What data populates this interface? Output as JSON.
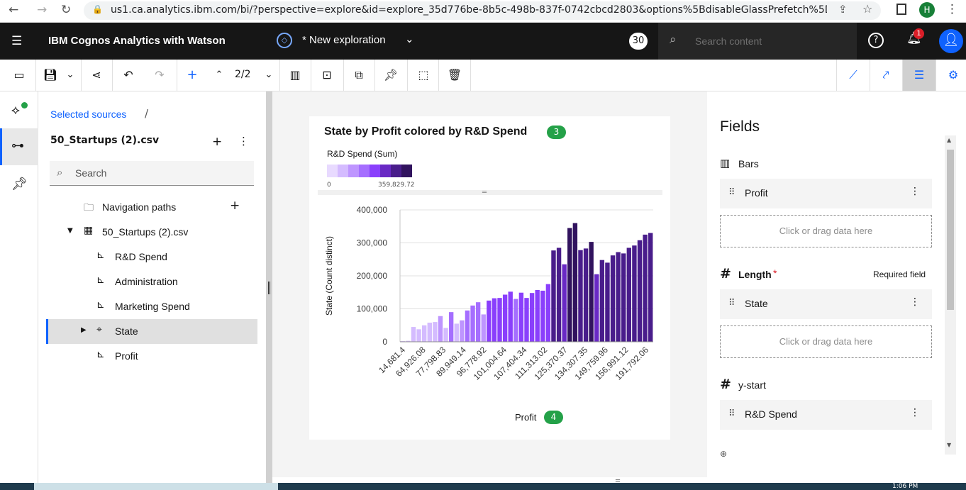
{
  "browser": {
    "url": "us1.ca.analytics.ibm.com/bi/?perspective=explore&id=explore_35d776be-8b5c-498b-837f-0742cbcd2803&options%5BdisableGlassPrefetch%5D=tr...",
    "profile_initial": "H"
  },
  "header": {
    "app_name": "IBM Cognos Analytics with Watson",
    "exploration_title": "* New exploration",
    "count": "30",
    "search_placeholder": "Search content",
    "notification_count": "1"
  },
  "toolbar": {
    "page_indicator": "2/2"
  },
  "sources": {
    "breadcrumb": "Selected sources",
    "breadcrumb_sep": "/",
    "file_name": "50_Startups (2).csv",
    "search_placeholder": "Search",
    "tree": [
      {
        "label": "Navigation paths",
        "icon": "folder-icon"
      },
      {
        "label": "50_Startups (2).csv",
        "icon": "table-icon"
      },
      {
        "label": "R&D Spend",
        "icon": "measure-icon"
      },
      {
        "label": "Administration",
        "icon": "measure-icon"
      },
      {
        "label": "Marketing Spend",
        "icon": "measure-icon"
      },
      {
        "label": "State",
        "icon": "location-icon"
      },
      {
        "label": "Profit",
        "icon": "measure-icon"
      }
    ]
  },
  "card": {
    "title": "State by Profit colored by R&D Spend",
    "title_badge": "3",
    "legend_title": "R&D Spend (Sum)",
    "legend_min": "0",
    "legend_max": "359,829.72",
    "x_badge": "4",
    "colors": [
      "#e8daff",
      "#d4bbff",
      "#be95ff",
      "#a56eff",
      "#8a3ffc",
      "#6929c4",
      "#491d8b",
      "#31135e"
    ]
  },
  "chart_data": {
    "type": "bar",
    "title": "State by Profit colored by R&D Spend",
    "xlabel": "Profit",
    "ylabel": "State (Count distinct)",
    "ylim": [
      0,
      400000
    ],
    "y_ticks": [
      "0",
      "100,000",
      "200,000",
      "300,000",
      "400,000"
    ],
    "x_tick_labels": [
      "14,681.4",
      "64,926.08",
      "77,798.83",
      "89,949.14",
      "96,778.92",
      "101,004.64",
      "107,404.34",
      "111,313.02",
      "125,370.37",
      "134,307.35",
      "149,759.96",
      "156,991.12",
      "191,792.06"
    ],
    "values": [
      2000,
      3000,
      45000,
      38000,
      50000,
      58000,
      60000,
      78000,
      42000,
      90000,
      55000,
      65000,
      95000,
      110000,
      120000,
      83000,
      125000,
      132000,
      133000,
      143000,
      152000,
      130000,
      149000,
      133000,
      148000,
      157000,
      155000,
      175000,
      277000,
      285000,
      235000,
      345000,
      360000,
      278000,
      283000,
      303000,
      205000,
      248000,
      240000,
      262000,
      272000,
      268000,
      285000,
      292000,
      308000,
      325000,
      330000
    ],
    "color_levels": [
      1,
      1,
      1,
      1,
      1,
      1,
      1,
      2,
      1,
      3,
      1,
      2,
      3,
      3,
      3,
      2,
      4,
      4,
      4,
      4,
      4,
      3,
      4,
      4,
      4,
      4,
      4,
      4,
      6,
      6,
      5,
      7,
      7,
      6,
      6,
      7,
      5,
      6,
      6,
      6,
      6,
      6,
      6,
      6,
      6,
      6,
      6
    ],
    "grid": true
  },
  "fields": {
    "title": "Fields",
    "bars_label": "Bars",
    "bars_item": "Profit",
    "drop_hint": "Click or drag data here",
    "length_label": "Length",
    "required_mark": "*",
    "required_text": "Required field",
    "length_item": "State",
    "ystart_label": "y-start",
    "ystart_item": "R&D Spend"
  },
  "taskbar": {
    "time": "1:06 PM"
  }
}
